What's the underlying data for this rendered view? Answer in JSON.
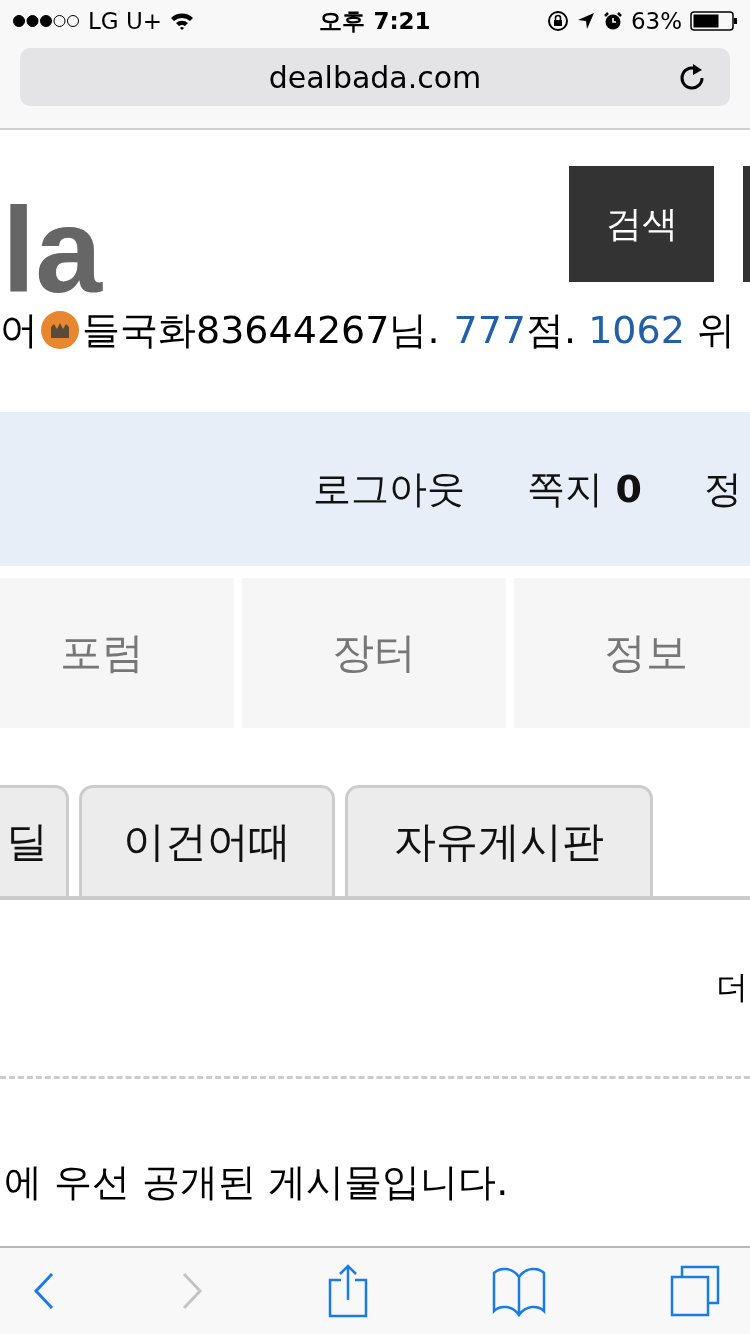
{
  "status_bar": {
    "carrier": "LG U+",
    "time": "오후 7:21",
    "battery": "63%"
  },
  "address_bar": {
    "url": "dealbada.com"
  },
  "header": {
    "logo": "la",
    "search_button": "검색"
  },
  "user_line": {
    "prefix": "어",
    "name": "들국화83644267",
    "name_suffix": "님.",
    "points": "777",
    "points_suffix": "점.",
    "rank": "1062",
    "rank_suffix": "위"
  },
  "links": [
    {
      "label": "로그아웃"
    },
    {
      "label": "쪽지",
      "count": "0"
    },
    {
      "label": "정"
    }
  ],
  "menu": [
    "포럼",
    "장터",
    "정보"
  ],
  "tabs": [
    {
      "label": "딜",
      "selected": false
    },
    {
      "label": "이건어때",
      "selected": false
    },
    {
      "label": "자유게시판",
      "selected": false
    }
  ],
  "more_link": "더",
  "notice": "에 우선 공개된 게시물입니다."
}
